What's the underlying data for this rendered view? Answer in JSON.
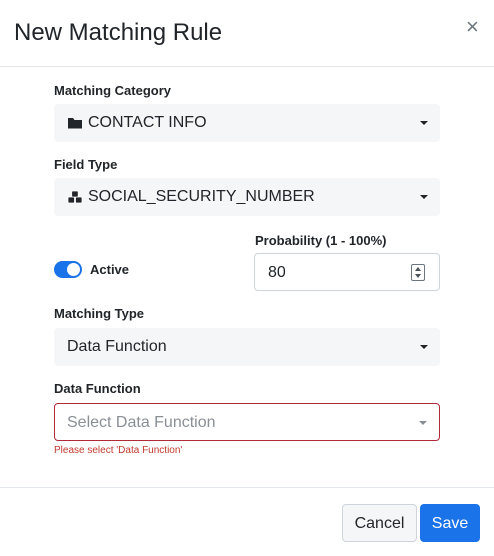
{
  "modal": {
    "title": "New Matching Rule",
    "close_glyph": "×"
  },
  "form": {
    "matching_category": {
      "label": "Matching Category",
      "value": "CONTACT INFO",
      "icon": "folder-icon"
    },
    "field_type": {
      "label": "Field Type",
      "value": "SOCIAL_SECURITY_NUMBER",
      "icon": "cubes-icon"
    },
    "active": {
      "label": "Active",
      "checked": true
    },
    "probability": {
      "label": "Probability (1 - 100%)",
      "value": "80"
    },
    "matching_type": {
      "label": "Matching Type",
      "value": "Data Function"
    },
    "data_function": {
      "label": "Data Function",
      "placeholder": "Select Data Function",
      "error": "Please select 'Data Function'"
    }
  },
  "footer": {
    "cancel_label": "Cancel",
    "save_label": "Save"
  },
  "colors": {
    "primary": "#1a73e8",
    "error": "#c0392b",
    "select_bg": "#f5f6f8"
  }
}
